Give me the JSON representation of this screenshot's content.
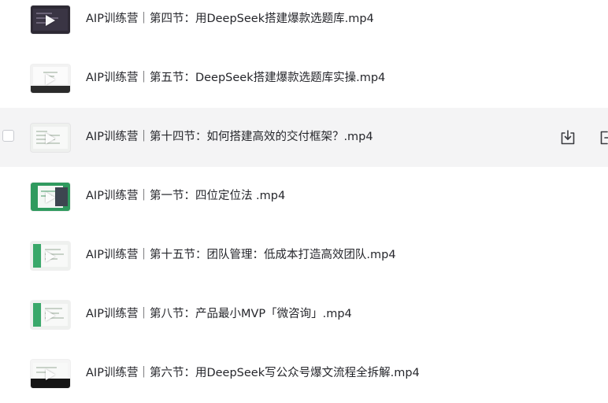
{
  "files": [
    {
      "name": "AIP训练营｜第四节：用DeepSeek搭建爆款选题库.mp4",
      "thumbnail": "dark-slide"
    },
    {
      "name": "AIP训练营｜第五节：DeepSeek搭建爆款选题库实操.mp4",
      "thumbnail": "white-slide"
    },
    {
      "name": "AIP训练营｜第十四节：如何搭建高效的交付框架？.mp4",
      "thumbnail": "light-slide"
    },
    {
      "name": "AIP训练营｜第一节：四位定位法 .mp4",
      "thumbnail": "green-slide"
    },
    {
      "name": "AIP训练营｜第十五节：团队管理：低成本打造高效团队.mp4",
      "thumbnail": "light-slide"
    },
    {
      "name": "AIP训练营｜第八节：产品最小MVP「微咨询」.mp4",
      "thumbnail": "light-slide"
    },
    {
      "name": "AIP训练营｜第六节：用DeepSeek写公众号爆文流程全拆解.mp4",
      "thumbnail": "black-footer-slide"
    }
  ],
  "hovered_row_index": 2,
  "row_actions": [
    "download-icon",
    "more-icon"
  ],
  "colors": {
    "hover_background": "#f4f4f5",
    "text": "#25262b",
    "icon": "#3a3b40"
  }
}
